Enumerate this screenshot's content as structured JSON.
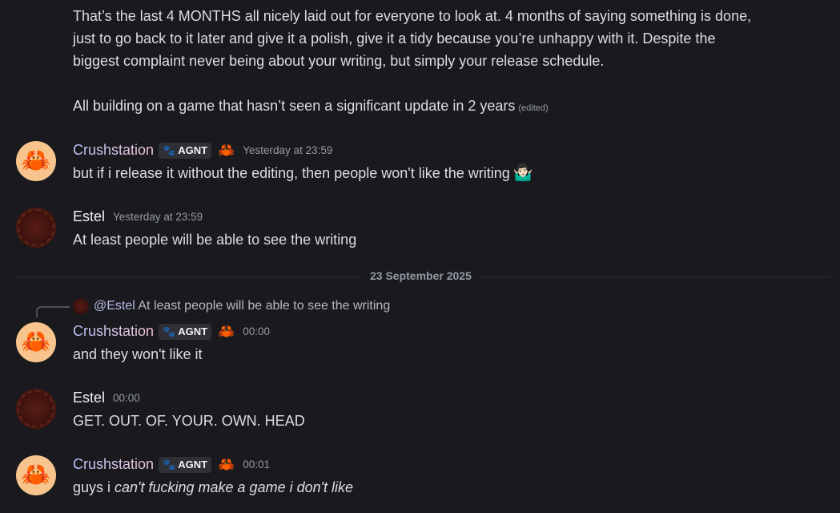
{
  "continuation": {
    "lines": [
      "That’s the last 4 MONTHS all nicely laid out for everyone to look at. 4 months of saying something is done,",
      "just to go back to it later and give it a polish, give it a tidy because you’re unhappy with it. Despite the",
      "biggest complaint never being about your writing, but simply your release schedule."
    ],
    "second_paragraph": "All building on a game that hasn’t seen a significant update in 2 years",
    "edited_label": "(edited)"
  },
  "users": {
    "crushstation": {
      "name": "Crushstation",
      "tag": "AGNT"
    },
    "estel": {
      "name": "Estel"
    }
  },
  "messages": [
    {
      "author": "Crushstation",
      "timestamp": "Yesterday at 23:59",
      "text": "but if i release it without the editing, then people won't like the writing",
      "emoji": "🤷🏻‍♂️"
    },
    {
      "author": "Estel",
      "timestamp": "Yesterday at 23:59",
      "text": "At least people will be able to see the writing"
    },
    {
      "author": "Crushstation",
      "timestamp": "00:00",
      "text": "and they won't like it"
    },
    {
      "author": "Estel",
      "timestamp": "00:00",
      "text": "GET. OUT. OF. YOUR. OWN. HEAD"
    },
    {
      "author": "Crushstation",
      "timestamp": "00:01",
      "text_plain": "guys i ",
      "text_italic": "can't fucking make a game i don't like"
    }
  ],
  "divider": {
    "label": "23 September 2025"
  },
  "reply": {
    "mention": "@Estel",
    "text": "At least people will be able to see the writing"
  },
  "icons": {
    "avatar_crab": "crab-icon",
    "tag_icon": "paw-icon",
    "badge": "crab-icon"
  }
}
